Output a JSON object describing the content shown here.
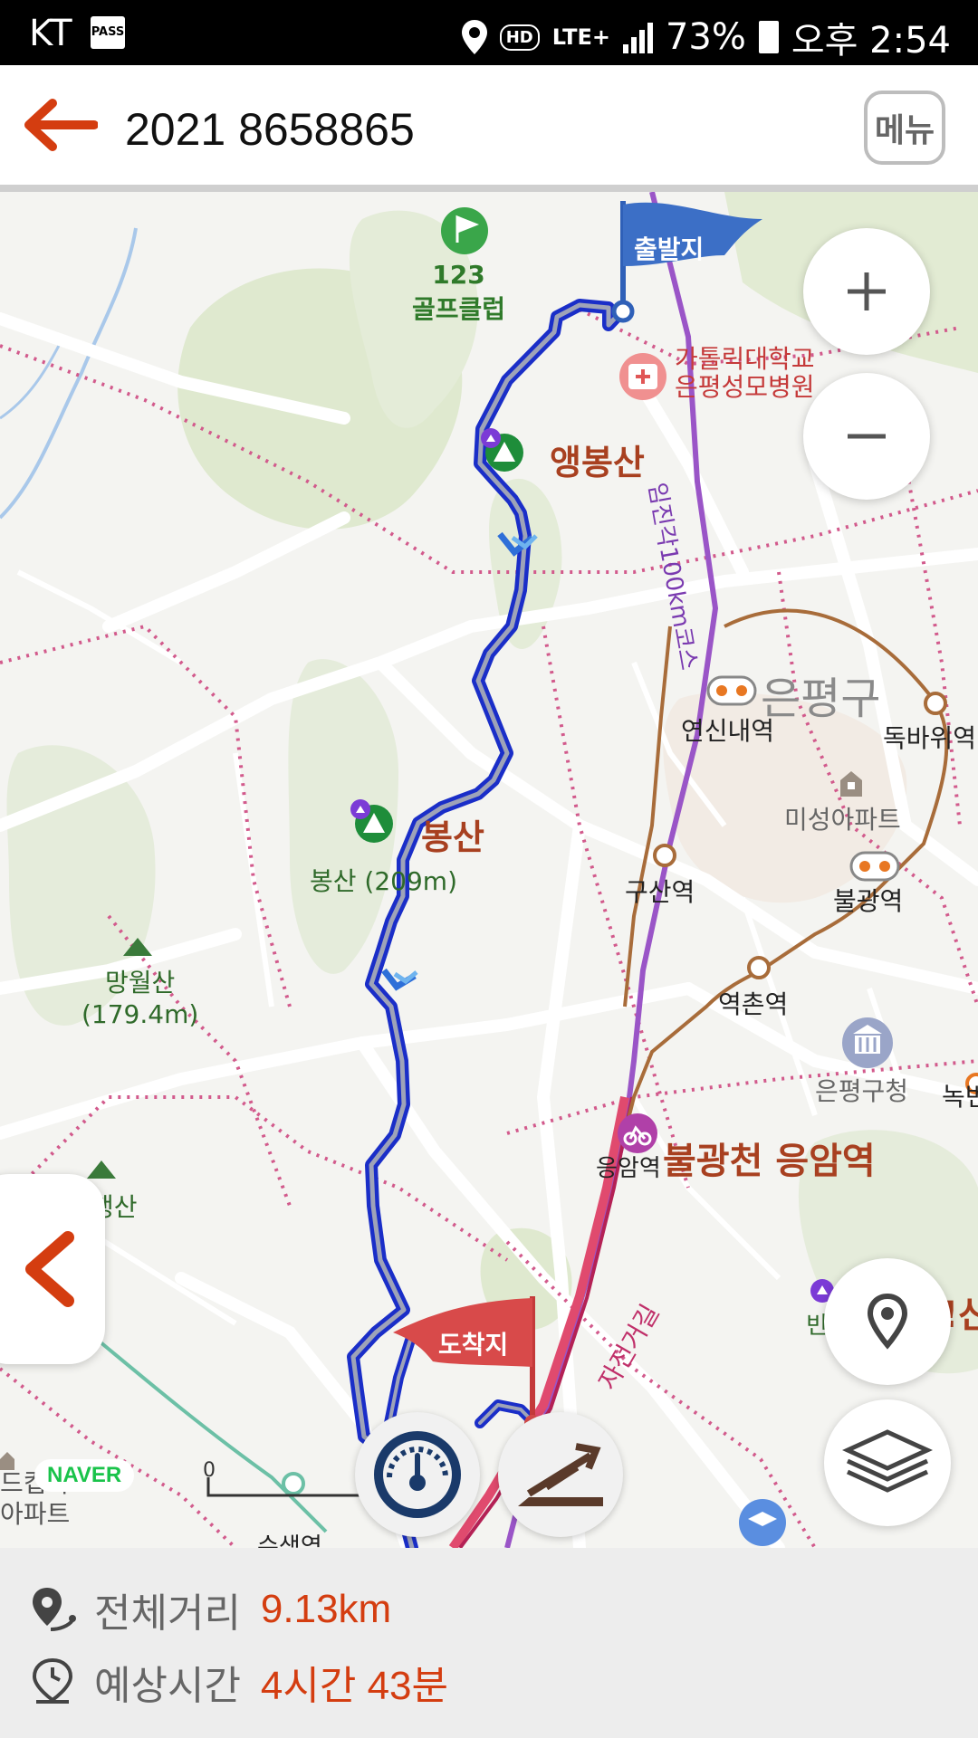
{
  "status_bar": {
    "carrier": "KT",
    "pass_badge": "PASS",
    "hd": "HD",
    "network": "LTE+",
    "battery": "73%",
    "time": "오후 2:54"
  },
  "header": {
    "title": "2021 8658865",
    "menu_label": "메뉴"
  },
  "map": {
    "start_flag": "출발지",
    "end_flag": "도착지",
    "poi": {
      "golf_club": "123\n골프클럽",
      "hospital": "가톨릭대학교\n은평성모병원",
      "mountain_aengbong": "앵봉산",
      "mountain_bong": "봉산",
      "mountain_bong_height": "봉산 (209m)",
      "mountain_mangwol": "망월산\n(179.4m)",
      "mountain_partial": "행산",
      "district": "은평구",
      "course": "임진각100km코스",
      "apartment": "미성아파트",
      "office": "은평구청",
      "bike_route": "불광천 응암역",
      "bottom_left": "드컵파크\n아파트",
      "bottom_center": "수색역",
      "bike_road": "자전거길",
      "right_edge_1": "녹번",
      "right_edge_2": "!산",
      "right_partial": "빈"
    },
    "stations": [
      "연신내역",
      "독바위역",
      "구산역",
      "불광역",
      "역촌역",
      "응암역"
    ],
    "scale_label": "0",
    "naver_logo": "NAVER",
    "route_color": "#1a2ec8",
    "accent_color": "#d43d10"
  },
  "footer": {
    "distance_label": "전체거리",
    "distance_value": "9.13km",
    "time_label": "예상시간",
    "time_value": "4시간 43분"
  }
}
